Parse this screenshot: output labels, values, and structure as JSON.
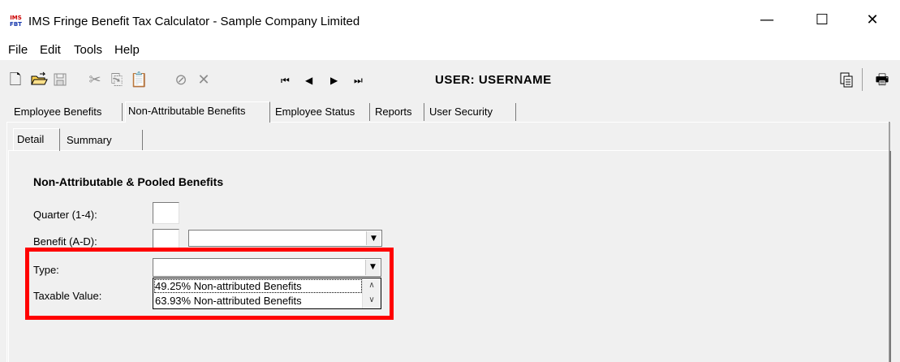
{
  "window": {
    "title": "IMS Fringe Benefit Tax Calculator - Sample Company Limited",
    "icon_text_top": "IMS",
    "icon_text_bottom": "FBT",
    "minimize": "—",
    "maximize": "☐",
    "close": "✕"
  },
  "menu": [
    "File",
    "Edit",
    "Tools",
    "Help"
  ],
  "toolbar": {
    "user_label": "USER: USERNAME",
    "icons": [
      "new-document-icon",
      "open-folder-icon",
      "save-icon",
      "cut-icon",
      "copy-icon",
      "paste-icon",
      "cancel-icon",
      "delete-icon",
      "first-record-icon",
      "previous-record-icon",
      "next-record-icon",
      "last-record-icon",
      "copy-report-icon",
      "print-icon"
    ]
  },
  "tabs": [
    "Employee Benefits",
    "Non-Attributable Benefits",
    "Employee Status",
    "Reports",
    "User Security"
  ],
  "active_tab": "Non-Attributable Benefits",
  "subtabs": [
    "Detail",
    "Summary"
  ],
  "active_subtab": "Detail",
  "form": {
    "heading": "Non-Attributable & Pooled Benefits",
    "quarter_label": "Quarter (1-4):",
    "quarter_value": "",
    "benefit_label": "Benefit (A-D):",
    "benefit_code": "",
    "benefit_desc": "",
    "type_label": "Type:",
    "type_value": "",
    "taxable_label": "Taxable Value:",
    "type_options": [
      "49.25% Non-attributed Benefits",
      "63.93% Non-attributed Benefits"
    ]
  },
  "colors": {
    "highlight": "#ff0000",
    "background": "#f0f0f0"
  }
}
